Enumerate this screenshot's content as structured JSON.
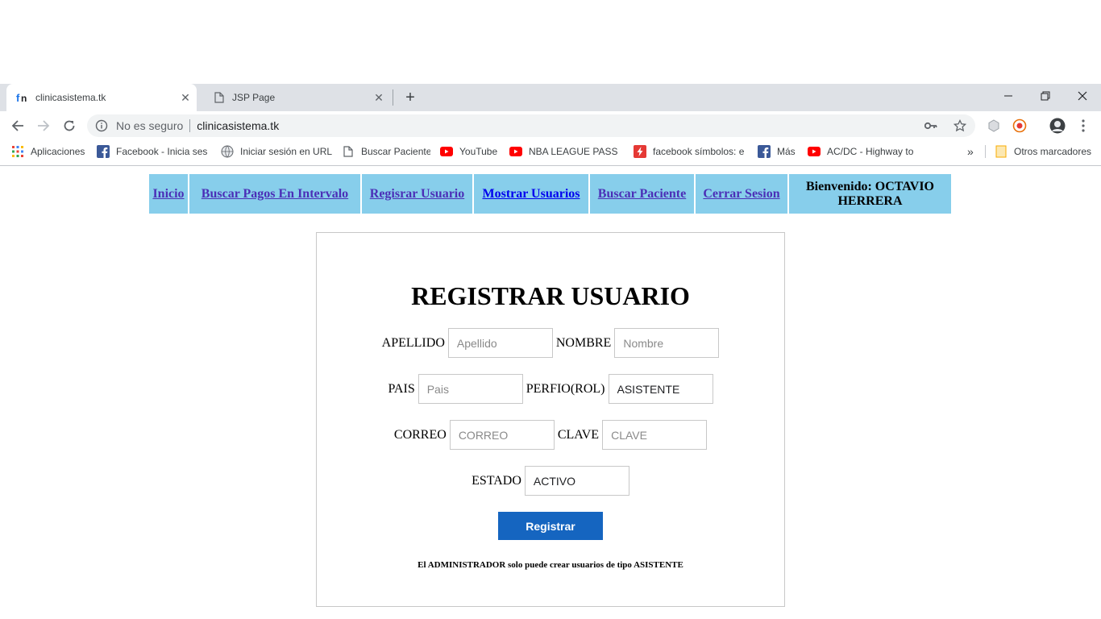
{
  "browser": {
    "tabs": [
      {
        "title": "clinicasistema.tk",
        "active": true
      },
      {
        "title": "JSP Page",
        "active": false
      }
    ],
    "address": {
      "security_text": "No es seguro",
      "url": "clinicasistema.tk"
    },
    "bookmarks": [
      {
        "label": "Aplicaciones",
        "icon": "apps-grid-icon"
      },
      {
        "label": "Facebook - Inicia sesi",
        "icon": "facebook-icon"
      },
      {
        "label": "Iniciar sesión en URL",
        "icon": "globe-icon"
      },
      {
        "label": "Buscar Paciente",
        "icon": "page-icon"
      },
      {
        "label": "YouTube",
        "icon": "youtube-icon"
      },
      {
        "label": "NBA LEAGUE PASS H",
        "icon": "youtube-icon"
      },
      {
        "label": "facebook símbolos: e",
        "icon": "flash-icon"
      },
      {
        "label": "Más",
        "icon": "facebook-icon"
      },
      {
        "label": "AC/DC - Highway to",
        "icon": "youtube-icon"
      }
    ],
    "overflow_label": "»",
    "other_bookmarks": "Otros marcadores"
  },
  "nav": {
    "items": [
      {
        "label": "Inicio"
      },
      {
        "label": "Buscar Pagos En Intervalo"
      },
      {
        "label": "Regisrar Usuario"
      },
      {
        "label": "Mostrar Usuarios"
      },
      {
        "label": "Buscar Paciente"
      },
      {
        "label": "Cerrar Sesion"
      }
    ],
    "welcome": "Bienvenido: OCTAVIO HERRERA"
  },
  "form": {
    "title": "REGISTRAR USUARIO",
    "apellido": {
      "label": "APELLIDO",
      "placeholder": "Apellido",
      "value": ""
    },
    "nombre": {
      "label": "NOMBRE",
      "placeholder": "Nombre",
      "value": ""
    },
    "pais": {
      "label": "PAIS",
      "placeholder": "Pais",
      "value": ""
    },
    "perfil": {
      "label": "PERFIO(ROL)",
      "value": "ASISTENTE"
    },
    "correo": {
      "label": "CORREO",
      "placeholder": "CORREO",
      "value": ""
    },
    "clave": {
      "label": "CLAVE",
      "placeholder": "CLAVE",
      "value": ""
    },
    "estado": {
      "label": "ESTADO",
      "value": "ACTIVO"
    },
    "submit_label": "Registrar",
    "note": "El ADMINISTRADOR solo puede crear usuarios de tipo ASISTENTE"
  },
  "colors": {
    "nav_bg": "#87ceeb",
    "button_bg": "#1565c0"
  }
}
